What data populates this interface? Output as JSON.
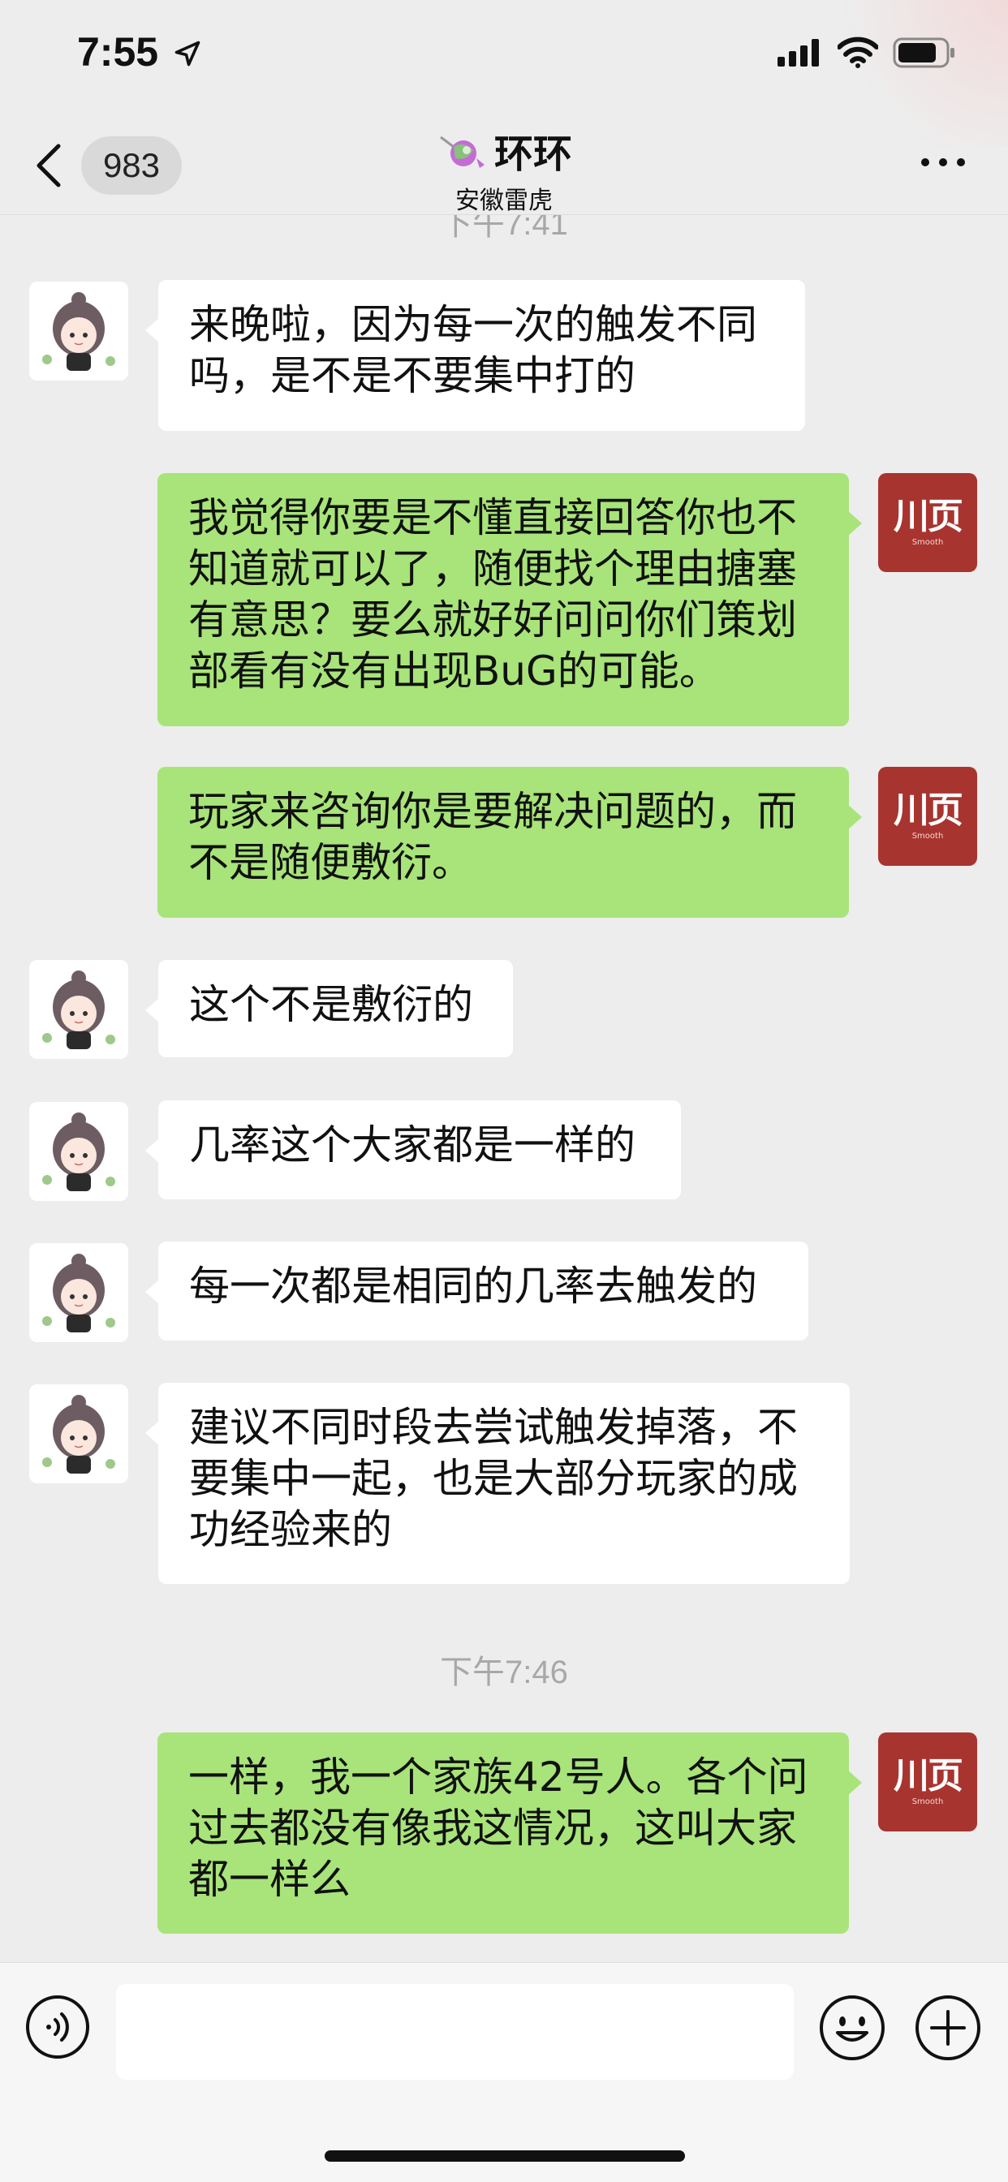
{
  "status_bar": {
    "time": "7:55"
  },
  "header": {
    "back_badge": "983",
    "title": "环环",
    "subtitle": "安徽雷虎",
    "icons": {
      "back": "chevron-left-icon",
      "title_decoration": "candy-icon",
      "more": "more-icon"
    }
  },
  "chat": {
    "time_dividers": [
      "下午7:41",
      "下午7:46"
    ],
    "messages": [
      {
        "side": "left",
        "text": "来晚啦，因为每一次的触发不同吗，是不是不要集中打的"
      },
      {
        "side": "right",
        "text": "我觉得你要是不懂直接回答你也不知道就可以了，随便找个理由搪塞有意思？要么就好好问问你们策划部看有没有出现BuG的可能。"
      },
      {
        "side": "right",
        "text": "玩家来咨询你是要解决问题的，而不是随便敷衍。"
      },
      {
        "side": "left",
        "text": "这个不是敷衍的"
      },
      {
        "side": "left",
        "text": "几率这个大家都是一样的"
      },
      {
        "side": "left",
        "text": "每一次都是相同的几率去触发的"
      },
      {
        "side": "left",
        "text": "建议不同时段去尝试触发掉落，不要集中一起，也是大部分玩家的成功经验来的"
      },
      {
        "side": "right",
        "text": "一样，我一个家族42号人。各个问过去都没有像我这情况，这叫大家都一样么"
      }
    ],
    "self_avatar": {
      "label": "川页",
      "sub_label": "Smooth"
    }
  },
  "input_bar": {
    "placeholder": "",
    "icons": {
      "voice": "voice-icon",
      "emoji": "emoji-icon",
      "plus": "plus-icon"
    }
  },
  "colors": {
    "background": "#ededed",
    "outgoing_bubble": "#a8e479",
    "incoming_bubble": "#ffffff",
    "self_avatar": "#a8342f"
  }
}
